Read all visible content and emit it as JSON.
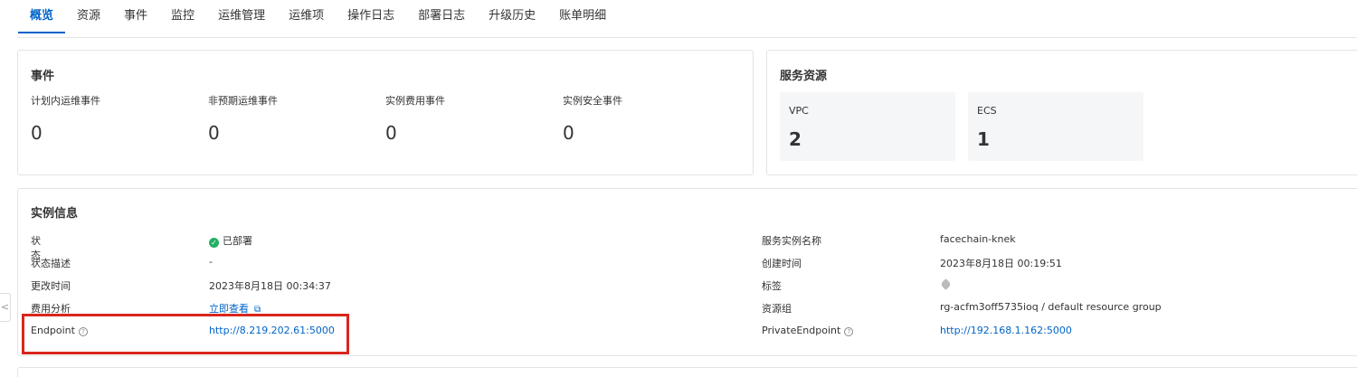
{
  "tabs": [
    {
      "label": "概览",
      "active": true
    },
    {
      "label": "资源"
    },
    {
      "label": "事件"
    },
    {
      "label": "监控"
    },
    {
      "label": "运维管理"
    },
    {
      "label": "运维项"
    },
    {
      "label": "操作日志"
    },
    {
      "label": "部署日志"
    },
    {
      "label": "升级历史"
    },
    {
      "label": "账单明细"
    }
  ],
  "events": {
    "title": "事件",
    "items": [
      {
        "label": "计划内运维事件",
        "value": "0"
      },
      {
        "label": "非预期运维事件",
        "value": "0"
      },
      {
        "label": "实例费用事件",
        "value": "0"
      },
      {
        "label": "实例安全事件",
        "value": "0"
      }
    ]
  },
  "service_resources": {
    "title": "服务资源",
    "items": [
      {
        "label": "VPC",
        "value": "2"
      },
      {
        "label": "ECS",
        "value": "1"
      }
    ]
  },
  "instance_info": {
    "title": "实例信息",
    "left": {
      "status_label": "状态",
      "status_value": "已部署",
      "status_desc_label": "状态描述",
      "status_desc_value": "-",
      "modified_label": "更改时间",
      "modified_value": "2023年8月18日 00:34:37",
      "cost_label": "费用分析",
      "cost_value": "立即查看",
      "endpoint_label": "Endpoint",
      "endpoint_value": "http://8.219.202.61:5000"
    },
    "right": {
      "name_label": "服务实例名称",
      "name_value": "facechain-knek",
      "created_label": "创建时间",
      "created_value": "2023年8月18日 00:19:51",
      "tags_label": "标签",
      "rg_label": "资源组",
      "rg_value": "rg-acfm3off5735ioq / default resource group",
      "private_label": "PrivateEndpoint",
      "private_value": "http://192.168.1.162:5000"
    }
  },
  "colors": {
    "accent": "#0064c8",
    "success": "#23b066",
    "highlight": "#d9261c"
  },
  "icons": {
    "status": "check-circle-icon",
    "help": "question-circle-icon",
    "external": "external-link-icon",
    "tag": "tag-icon",
    "collapse": "chevron-left-icon"
  }
}
